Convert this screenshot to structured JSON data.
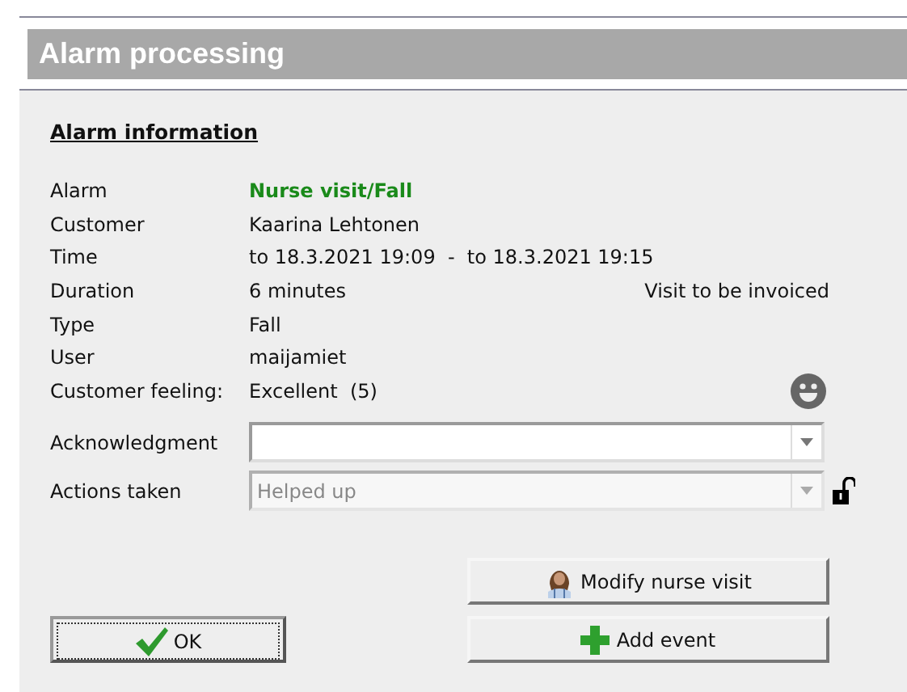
{
  "window": {
    "title": "Alarm processing"
  },
  "section": {
    "title": "Alarm information"
  },
  "fields": [
    {
      "label": "Alarm",
      "value": "Nurse visit/Fall",
      "kind": "highlight"
    },
    {
      "label": "Customer",
      "value": "Kaarina Lehtonen",
      "kind": "plain"
    },
    {
      "label": "Time",
      "value": "to 18.3.2021 19:09  -  to 18.3.2021 19:15",
      "kind": "plain"
    },
    {
      "label": "Duration",
      "value": "6 minutes",
      "kind": "plain",
      "note": "Visit to be invoiced"
    },
    {
      "label": "Type",
      "value": "Fall",
      "kind": "plain"
    },
    {
      "label": "User",
      "value": "maijamiet",
      "kind": "plain"
    },
    {
      "label": "Customer feeling:",
      "value": "Excellent  (5)",
      "kind": "feeling"
    }
  ],
  "dropdowns": [
    {
      "label": "Acknowledgment",
      "disabled": false,
      "locked": false
    },
    {
      "label": "Actions taken",
      "value": "Helped up",
      "disabled": true,
      "locked": true
    }
  ],
  "buttons": [
    {
      "label": "Modify nurse visit",
      "kind": "nurse"
    },
    {
      "label": "Add event",
      "kind": "add"
    }
  ],
  "ok_button": {
    "label": "OK"
  }
}
